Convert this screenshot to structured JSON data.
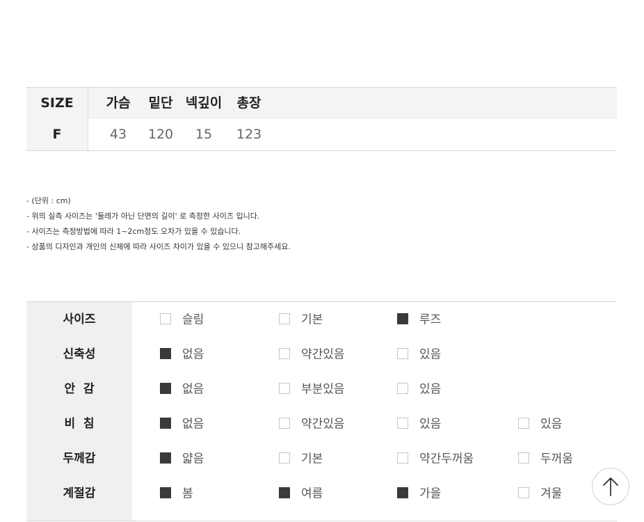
{
  "size_table": {
    "header_label": "SIZE",
    "columns": [
      "가슴",
      "밑단",
      "넥깊이",
      "총장"
    ],
    "row_label": "F",
    "values": [
      "43",
      "120",
      "15",
      "123"
    ]
  },
  "notes": [
    "- (단위 : cm)",
    "- 위의 실측 사이즈는 '둘레가 아닌 단면의 길이' 로 측정한 사이즈 입니다.",
    "- 사이즈는 측정방법에 따라 1~2cm정도 오차가 있을 수 있습니다.",
    "- 상품의 디자인과 개인의 신체에 따라 사이즈 차이가 있을 수 있으니 참고해주세요."
  ],
  "attributes": [
    {
      "label": "사이즈",
      "options": [
        {
          "text": "슬림",
          "checked": false
        },
        {
          "text": "기본",
          "checked": false
        },
        {
          "text": "루즈",
          "checked": true
        }
      ]
    },
    {
      "label": "신축성",
      "options": [
        {
          "text": "없음",
          "checked": true
        },
        {
          "text": "약간있음",
          "checked": false
        },
        {
          "text": "있음",
          "checked": false
        }
      ]
    },
    {
      "label": "안  감",
      "options": [
        {
          "text": "없음",
          "checked": true
        },
        {
          "text": "부분있음",
          "checked": false
        },
        {
          "text": "있음",
          "checked": false
        }
      ]
    },
    {
      "label": "비  침",
      "options": [
        {
          "text": "없음",
          "checked": true
        },
        {
          "text": "약간있음",
          "checked": false
        },
        {
          "text": "있음",
          "checked": false
        },
        {
          "text": "있음",
          "checked": false
        }
      ]
    },
    {
      "label": "두께감",
      "options": [
        {
          "text": "얇음",
          "checked": true
        },
        {
          "text": "기본",
          "checked": false
        },
        {
          "text": "약간두꺼움",
          "checked": false
        },
        {
          "text": "두꺼움",
          "checked": false
        }
      ]
    },
    {
      "label": "계절감",
      "options": [
        {
          "text": "봄",
          "checked": true
        },
        {
          "text": "여름",
          "checked": true
        },
        {
          "text": "가을",
          "checked": true
        },
        {
          "text": "겨울",
          "checked": false
        }
      ]
    }
  ],
  "scroll_top": {
    "icon": "arrow-up-icon"
  }
}
